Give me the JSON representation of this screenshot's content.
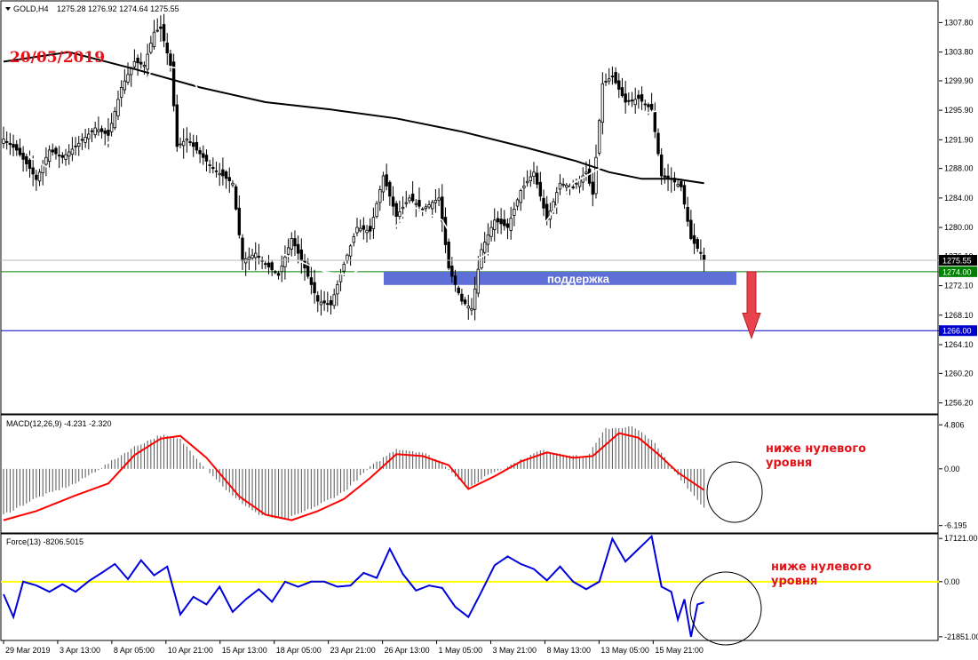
{
  "header": {
    "symbol": "GOLD,H4",
    "ohlc": "1275.28 1276.92 1274.64 1275.55",
    "date_stamp": "20/05/2019"
  },
  "colors": {
    "background": "#ffffff",
    "candle": "#000000",
    "sma_long": "#000000",
    "sma_short": "#ffffff",
    "support_zone": "#5f6fd8",
    "support_line": "#008000",
    "target_line": "#0000cc",
    "arrow": "#e8434c",
    "macd_signal": "#ff0000",
    "force_line": "#0000dd",
    "force_zero": "#ffff00",
    "annotation": "#e0141a"
  },
  "chart_data": [
    {
      "type": "candlestick",
      "panel": "price",
      "title": "GOLD,H4",
      "ylim": [
        1254.7,
        1310.5
      ],
      "y_ticks": [
        "1307.80",
        "1303.80",
        "1299.90",
        "1295.90",
        "1291.90",
        "1288.00",
        "1284.00",
        "1280.00",
        "1276.10",
        "1272.10",
        "1268.10",
        "1264.10",
        "1260.20",
        "1256.20"
      ],
      "current_price_label": "1275.55",
      "levels": [
        {
          "label": "1274.00",
          "value": 1274.0,
          "color": "#008000"
        },
        {
          "label": "1266.00",
          "value": 1266.0,
          "color": "#0000cc"
        }
      ],
      "support_zone": {
        "label": "поддержка",
        "from": 1272.2,
        "to": 1274.0
      },
      "arrow": {
        "direction": "down",
        "from": 1274.0,
        "to": 1265.0
      },
      "x_labels": [
        "29 Mar 2019",
        "3 Apr 13:00",
        "8 Apr 05:00",
        "10 Apr 21:00",
        "15 Apr 13:00",
        "18 Apr 05:00",
        "23 Apr 21:00",
        "26 Apr 13:00",
        "1 May 05:00",
        "3 May 21:00",
        "8 May 13:00",
        "13 May 05:00",
        "15 May 21:00"
      ],
      "closes": [
        {
          "bar": 0,
          "close": 1292.0
        },
        {
          "bar": 4,
          "close": 1290.5
        },
        {
          "bar": 8,
          "close": 1288.0
        },
        {
          "bar": 10,
          "close": 1286.5
        },
        {
          "bar": 14,
          "close": 1290.5
        },
        {
          "bar": 18,
          "close": 1289.5
        },
        {
          "bar": 22,
          "close": 1291.0
        },
        {
          "bar": 28,
          "close": 1293.5
        },
        {
          "bar": 32,
          "close": 1292.5
        },
        {
          "bar": 36,
          "close": 1299.0
        },
        {
          "bar": 40,
          "close": 1302.5
        },
        {
          "bar": 43,
          "close": 1302.0
        },
        {
          "bar": 46,
          "close": 1306.5
        },
        {
          "bar": 48,
          "close": 1307.0
        },
        {
          "bar": 51,
          "close": 1302.0
        },
        {
          "bar": 53,
          "close": 1291.0
        },
        {
          "bar": 56,
          "close": 1292.0
        },
        {
          "bar": 60,
          "close": 1290.0
        },
        {
          "bar": 64,
          "close": 1288.0
        },
        {
          "bar": 70,
          "close": 1286.0
        },
        {
          "bar": 73,
          "close": 1275.5
        },
        {
          "bar": 77,
          "close": 1276.5
        },
        {
          "bar": 80,
          "close": 1275.0
        },
        {
          "bar": 84,
          "close": 1273.5
        },
        {
          "bar": 88,
          "close": 1278.5
        },
        {
          "bar": 92,
          "close": 1274.5
        },
        {
          "bar": 96,
          "close": 1270.0
        },
        {
          "bar": 100,
          "close": 1269.5
        },
        {
          "bar": 104,
          "close": 1275.0
        },
        {
          "bar": 108,
          "close": 1280.0
        },
        {
          "bar": 112,
          "close": 1279.5
        },
        {
          "bar": 116,
          "close": 1287.0
        },
        {
          "bar": 120,
          "close": 1281.5
        },
        {
          "bar": 124,
          "close": 1284.0
        },
        {
          "bar": 128,
          "close": 1282.5
        },
        {
          "bar": 133,
          "close": 1284.0
        },
        {
          "bar": 136,
          "close": 1274.5
        },
        {
          "bar": 140,
          "close": 1270.0
        },
        {
          "bar": 143,
          "close": 1269.0
        },
        {
          "bar": 146,
          "close": 1277.0
        },
        {
          "bar": 150,
          "close": 1281.0
        },
        {
          "bar": 154,
          "close": 1280.0
        },
        {
          "bar": 158,
          "close": 1285.0
        },
        {
          "bar": 162,
          "close": 1287.5
        },
        {
          "bar": 166,
          "close": 1281.0
        },
        {
          "bar": 170,
          "close": 1286.0
        },
        {
          "bar": 174,
          "close": 1285.5
        },
        {
          "bar": 178,
          "close": 1287.5
        },
        {
          "bar": 180,
          "close": 1284.5
        },
        {
          "bar": 183,
          "close": 1299.5
        },
        {
          "bar": 186,
          "close": 1300.5
        },
        {
          "bar": 190,
          "close": 1297.0
        },
        {
          "bar": 194,
          "close": 1297.5
        },
        {
          "bar": 198,
          "close": 1296.0
        },
        {
          "bar": 201,
          "close": 1287.0
        },
        {
          "bar": 204,
          "close": 1286.5
        },
        {
          "bar": 207,
          "close": 1285.5
        },
        {
          "bar": 210,
          "close": 1278.5
        },
        {
          "bar": 213,
          "close": 1276.5
        },
        {
          "bar": 214,
          "close": 1275.55
        }
      ],
      "sma_long": [
        {
          "bar": 0,
          "value": 1302.5
        },
        {
          "bar": 20,
          "value": 1303.8
        },
        {
          "bar": 40,
          "value": 1301.5
        },
        {
          "bar": 60,
          "value": 1299.0
        },
        {
          "bar": 80,
          "value": 1297.0
        },
        {
          "bar": 100,
          "value": 1296.0
        },
        {
          "bar": 120,
          "value": 1294.8
        },
        {
          "bar": 140,
          "value": 1293.0
        },
        {
          "bar": 160,
          "value": 1290.8
        },
        {
          "bar": 175,
          "value": 1289.0
        },
        {
          "bar": 185,
          "value": 1287.5
        },
        {
          "bar": 195,
          "value": 1286.6
        },
        {
          "bar": 205,
          "value": 1286.6
        },
        {
          "bar": 214,
          "value": 1286.0
        }
      ],
      "sma_short": [
        {
          "bar": 0,
          "value": 1298.0
        },
        {
          "bar": 8,
          "value": 1289.5
        },
        {
          "bar": 16,
          "value": 1287.5
        },
        {
          "bar": 26,
          "value": 1288.5
        },
        {
          "bar": 36,
          "value": 1293.5
        },
        {
          "bar": 46,
          "value": 1302.0
        },
        {
          "bar": 56,
          "value": 1301.5
        },
        {
          "bar": 64,
          "value": 1295.0
        },
        {
          "bar": 72,
          "value": 1286.0
        },
        {
          "bar": 80,
          "value": 1277.5
        },
        {
          "bar": 90,
          "value": 1275.5
        },
        {
          "bar": 98,
          "value": 1274.0
        },
        {
          "bar": 106,
          "value": 1273.5
        },
        {
          "bar": 114,
          "value": 1276.0
        },
        {
          "bar": 124,
          "value": 1283.0
        },
        {
          "bar": 134,
          "value": 1281.0
        },
        {
          "bar": 142,
          "value": 1275.0
        },
        {
          "bar": 150,
          "value": 1277.0
        },
        {
          "bar": 158,
          "value": 1277.5
        },
        {
          "bar": 166,
          "value": 1281.0
        },
        {
          "bar": 174,
          "value": 1286.0
        },
        {
          "bar": 182,
          "value": 1288.0
        },
        {
          "bar": 188,
          "value": 1291.0
        },
        {
          "bar": 196,
          "value": 1295.5
        },
        {
          "bar": 202,
          "value": 1296.0
        },
        {
          "bar": 208,
          "value": 1292.0
        },
        {
          "bar": 214,
          "value": 1288.5
        }
      ]
    },
    {
      "type": "histogram-line",
      "panel": "macd",
      "title": "MACD(12,26,9) -4.231 -2.320",
      "ylim": [
        -7.0,
        5.8
      ],
      "y_ticks": [
        "4.806",
        "0.00",
        "-6.195"
      ],
      "annotation": [
        "ниже нулевого",
        "уровня"
      ],
      "histogram": [
        {
          "bar": 0,
          "value": -5.0
        },
        {
          "bar": 10,
          "value": -3.2
        },
        {
          "bar": 22,
          "value": -1.6
        },
        {
          "bar": 32,
          "value": 0.6
        },
        {
          "bar": 40,
          "value": 2.4
        },
        {
          "bar": 48,
          "value": 3.7
        },
        {
          "bar": 54,
          "value": 3.2
        },
        {
          "bar": 62,
          "value": 0.0
        },
        {
          "bar": 70,
          "value": -3.0
        },
        {
          "bar": 78,
          "value": -5.0
        },
        {
          "bar": 86,
          "value": -5.6
        },
        {
          "bar": 96,
          "value": -4.0
        },
        {
          "bar": 104,
          "value": -2.5
        },
        {
          "bar": 112,
          "value": 0.2
        },
        {
          "bar": 120,
          "value": 2.2
        },
        {
          "bar": 128,
          "value": 1.8
        },
        {
          "bar": 134,
          "value": 0.7
        },
        {
          "bar": 142,
          "value": -2.2
        },
        {
          "bar": 148,
          "value": -0.6
        },
        {
          "bar": 156,
          "value": 0.6
        },
        {
          "bar": 164,
          "value": 2.0
        },
        {
          "bar": 172,
          "value": 1.6
        },
        {
          "bar": 178,
          "value": 1.2
        },
        {
          "bar": 184,
          "value": 4.4
        },
        {
          "bar": 192,
          "value": 4.6
        },
        {
          "bar": 198,
          "value": 3.2
        },
        {
          "bar": 204,
          "value": 0.2
        },
        {
          "bar": 210,
          "value": -2.5
        },
        {
          "bar": 214,
          "value": -4.231
        }
      ],
      "signal": [
        {
          "bar": 0,
          "value": -5.6
        },
        {
          "bar": 10,
          "value": -4.6
        },
        {
          "bar": 22,
          "value": -2.9
        },
        {
          "bar": 32,
          "value": -1.6
        },
        {
          "bar": 40,
          "value": 1.5
        },
        {
          "bar": 48,
          "value": 3.3
        },
        {
          "bar": 54,
          "value": 3.6
        },
        {
          "bar": 62,
          "value": 1.2
        },
        {
          "bar": 72,
          "value": -3.0
        },
        {
          "bar": 80,
          "value": -5.0
        },
        {
          "bar": 88,
          "value": -5.6
        },
        {
          "bar": 96,
          "value": -4.6
        },
        {
          "bar": 104,
          "value": -3.3
        },
        {
          "bar": 112,
          "value": -1.0
        },
        {
          "bar": 120,
          "value": 1.6
        },
        {
          "bar": 128,
          "value": 1.4
        },
        {
          "bar": 136,
          "value": 0.4
        },
        {
          "bar": 142,
          "value": -2.2
        },
        {
          "bar": 150,
          "value": -0.8
        },
        {
          "bar": 158,
          "value": 0.8
        },
        {
          "bar": 166,
          "value": 1.8
        },
        {
          "bar": 174,
          "value": 1.2
        },
        {
          "bar": 180,
          "value": 1.4
        },
        {
          "bar": 188,
          "value": 3.9
        },
        {
          "bar": 194,
          "value": 3.4
        },
        {
          "bar": 200,
          "value": 1.6
        },
        {
          "bar": 206,
          "value": -0.4
        },
        {
          "bar": 214,
          "value": -2.32
        }
      ]
    },
    {
      "type": "line",
      "panel": "force",
      "title": "Force(13) -8206.5015",
      "ylim": [
        -23300,
        18600
      ],
      "y_ticks": [
        "17121.00",
        "0.00",
        "-21851.00"
      ],
      "annotation": [
        "ниже нулевого",
        "уровня"
      ],
      "values": [
        {
          "bar": 0,
          "value": -5000
        },
        {
          "bar": 3,
          "value": -14000
        },
        {
          "bar": 6,
          "value": 0
        },
        {
          "bar": 10,
          "value": -1500
        },
        {
          "bar": 14,
          "value": -4000
        },
        {
          "bar": 18,
          "value": -1000
        },
        {
          "bar": 22,
          "value": -4000
        },
        {
          "bar": 26,
          "value": 200
        },
        {
          "bar": 30,
          "value": 3500
        },
        {
          "bar": 34,
          "value": 7000
        },
        {
          "bar": 38,
          "value": 1000
        },
        {
          "bar": 42,
          "value": 8500
        },
        {
          "bar": 46,
          "value": 2500
        },
        {
          "bar": 50,
          "value": 6000
        },
        {
          "bar": 54,
          "value": -13000
        },
        {
          "bar": 58,
          "value": -6000
        },
        {
          "bar": 62,
          "value": -9000
        },
        {
          "bar": 66,
          "value": -2000
        },
        {
          "bar": 70,
          "value": -12000
        },
        {
          "bar": 74,
          "value": -7000
        },
        {
          "bar": 78,
          "value": -3000
        },
        {
          "bar": 82,
          "value": -8000
        },
        {
          "bar": 86,
          "value": 0
        },
        {
          "bar": 90,
          "value": -2000
        },
        {
          "bar": 94,
          "value": 0
        },
        {
          "bar": 98,
          "value": 0
        },
        {
          "bar": 102,
          "value": -2000
        },
        {
          "bar": 106,
          "value": -1500
        },
        {
          "bar": 110,
          "value": 3500
        },
        {
          "bar": 114,
          "value": 1500
        },
        {
          "bar": 118,
          "value": 13000
        },
        {
          "bar": 122,
          "value": 3000
        },
        {
          "bar": 126,
          "value": -3500
        },
        {
          "bar": 130,
          "value": -1500
        },
        {
          "bar": 134,
          "value": -2500
        },
        {
          "bar": 138,
          "value": -10000
        },
        {
          "bar": 142,
          "value": -14000
        },
        {
          "bar": 146,
          "value": -4000
        },
        {
          "bar": 150,
          "value": 6500
        },
        {
          "bar": 154,
          "value": 10000
        },
        {
          "bar": 158,
          "value": 7000
        },
        {
          "bar": 162,
          "value": 5000
        },
        {
          "bar": 166,
          "value": 500
        },
        {
          "bar": 170,
          "value": 6000
        },
        {
          "bar": 174,
          "value": 0
        },
        {
          "bar": 178,
          "value": -3000
        },
        {
          "bar": 182,
          "value": 0
        },
        {
          "bar": 186,
          "value": 17000
        },
        {
          "bar": 190,
          "value": 8000
        },
        {
          "bar": 194,
          "value": 13000
        },
        {
          "bar": 198,
          "value": 18000
        },
        {
          "bar": 201,
          "value": -2000
        },
        {
          "bar": 204,
          "value": -4000
        },
        {
          "bar": 206,
          "value": -15000
        },
        {
          "bar": 208,
          "value": -7000
        },
        {
          "bar": 210,
          "value": -21851
        },
        {
          "bar": 212,
          "value": -9000
        },
        {
          "bar": 214,
          "value": -8206.5
        }
      ]
    }
  ]
}
